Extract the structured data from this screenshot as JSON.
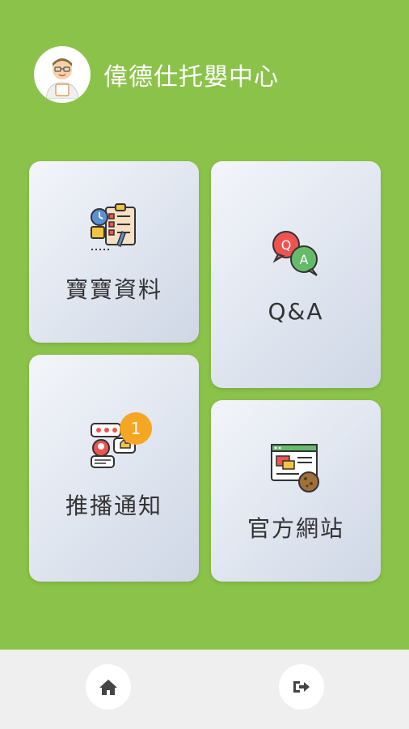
{
  "header": {
    "title": "偉德仕托嬰中心",
    "avatar_icon": "doctor-avatar-icon"
  },
  "menu": {
    "baby_data": {
      "label": "寶寶資料",
      "icon": "baby-profile-icon"
    },
    "qa": {
      "label": "Q&A",
      "icon": "qa-bubbles-icon"
    },
    "push": {
      "label": "推播通知",
      "icon": "notification-icon",
      "badge": "1"
    },
    "website": {
      "label": "官方網站",
      "icon": "website-icon"
    }
  },
  "bottom_nav": {
    "home_icon": "home-icon",
    "logout_icon": "logout-icon"
  },
  "colors": {
    "background": "#8BC34A",
    "badge": "#F5A623",
    "bottom_bar": "#EFEFEF"
  }
}
